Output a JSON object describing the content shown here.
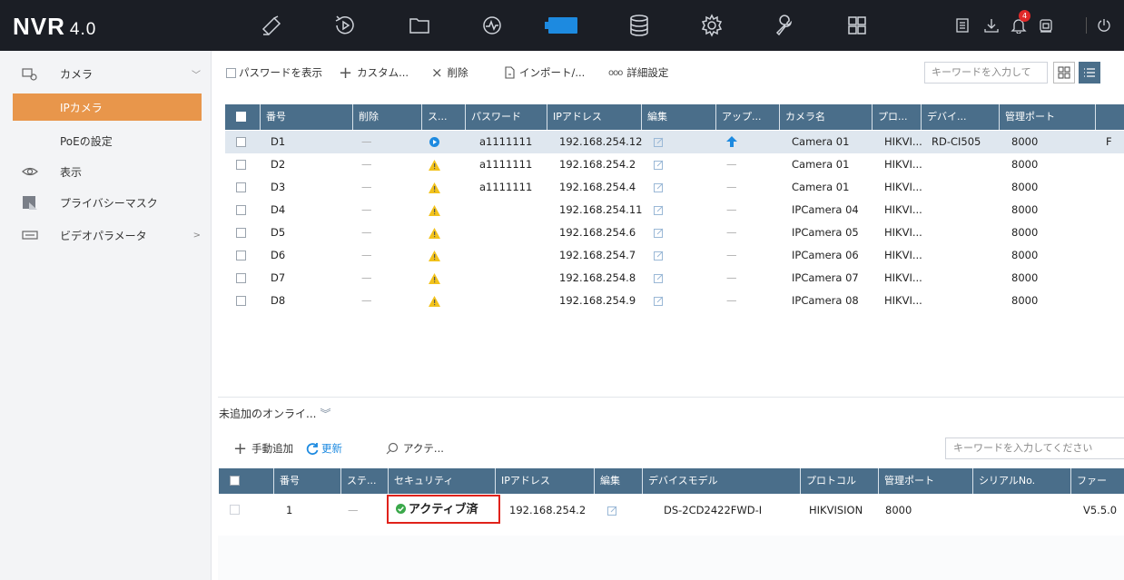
{
  "app": {
    "brand": "NVR",
    "version": "4.0"
  },
  "topnav": {
    "icons": [
      "live-view-icon",
      "playback-icon",
      "file-management-icon",
      "smart-analysis-icon",
      "camera-icon",
      "storage-icon",
      "system-icon",
      "maintenance-icon",
      "grid-icon"
    ],
    "right_icons": [
      "log-icon",
      "download-icon",
      "alarm-icon",
      "lock-icon",
      "power-icon"
    ],
    "alarm_count": "4",
    "active_index": 4
  },
  "sidebar": {
    "items": [
      {
        "label": "カメラ",
        "icon": "camera-icon",
        "chevron": "﹀"
      },
      {
        "label": "IPカメラ"
      },
      {
        "label": "PoEの設定"
      },
      {
        "label": "表示",
        "icon": "eye-icon"
      },
      {
        "label": "プライバシーマスク",
        "icon": "privacy-mask-icon"
      },
      {
        "label": "ビデオパラメータ",
        "icon": "video-param-icon",
        "chevron": ">"
      }
    ]
  },
  "toolbar": {
    "show_password": "パスワードを表示",
    "custom": "カスタム...",
    "delete": "削除",
    "import": "インポート/...",
    "advanced": "詳細設定",
    "search_placeholder": "キーワードを入力して"
  },
  "camera_table": {
    "headers": [
      "番号",
      "削除",
      "ス...",
      "パスワード",
      "IPアドレス",
      "編集",
      "アップ...",
      "カメラ名",
      "プロ...",
      "デバイ...",
      "管理ポート"
    ],
    "rows": [
      {
        "no": "D1",
        "delete": "—",
        "status": "ok",
        "password": "a1111111",
        "ip": "192.168.254.12",
        "upgrade": "up",
        "name": "Camera 01",
        "protocol": "HIKVI...",
        "device": "RD-CI505",
        "port": "8000",
        "extra": "F"
      },
      {
        "no": "D2",
        "delete": "—",
        "status": "warn",
        "password": "a1111111",
        "ip": "192.168.254.2",
        "upgrade": "—",
        "name": "Camera 01",
        "protocol": "HIKVI...",
        "device": "",
        "port": "8000",
        "extra": ""
      },
      {
        "no": "D3",
        "delete": "—",
        "status": "warn",
        "password": "a1111111",
        "ip": "192.168.254.4",
        "upgrade": "—",
        "name": "Camera 01",
        "protocol": "HIKVI...",
        "device": "",
        "port": "8000",
        "extra": ""
      },
      {
        "no": "D4",
        "delete": "—",
        "status": "warn",
        "password": "",
        "ip": "192.168.254.11",
        "upgrade": "—",
        "name": "IPCamera 04",
        "protocol": "HIKVI...",
        "device": "",
        "port": "8000",
        "extra": ""
      },
      {
        "no": "D5",
        "delete": "—",
        "status": "warn",
        "password": "",
        "ip": "192.168.254.6",
        "upgrade": "—",
        "name": "IPCamera 05",
        "protocol": "HIKVI...",
        "device": "",
        "port": "8000",
        "extra": ""
      },
      {
        "no": "D6",
        "delete": "—",
        "status": "warn",
        "password": "",
        "ip": "192.168.254.7",
        "upgrade": "—",
        "name": "IPCamera 06",
        "protocol": "HIKVI...",
        "device": "",
        "port": "8000",
        "extra": ""
      },
      {
        "no": "D7",
        "delete": "—",
        "status": "warn",
        "password": "",
        "ip": "192.168.254.8",
        "upgrade": "—",
        "name": "IPCamera 07",
        "protocol": "HIKVI...",
        "device": "",
        "port": "8000",
        "extra": ""
      },
      {
        "no": "D8",
        "delete": "—",
        "status": "warn",
        "password": "",
        "ip": "192.168.254.9",
        "upgrade": "—",
        "name": "IPCamera 08",
        "protocol": "HIKVI...",
        "device": "",
        "port": "8000",
        "extra": ""
      }
    ]
  },
  "online_panel": {
    "title": "未追加のオンライ...",
    "collapse": "≫",
    "manual_add": "手動追加",
    "refresh": "更新",
    "activate": "アクテ...",
    "search_placeholder": "キーワードを入力してください",
    "headers": [
      "番号",
      "ステ...",
      "セキュリティ",
      "IPアドレス",
      "編集",
      "デバイスモデル",
      "プロトコル",
      "管理ポート",
      "シリアルNo.",
      "ファー"
    ],
    "rows": [
      {
        "no": "1",
        "status": "—",
        "security": "アクティブ済",
        "ip": "192.168.254.2",
        "model": "DS-2CD2422FWD-I",
        "protocol": "HIKVISION",
        "port": "8000",
        "serial": "",
        "firmware": "V5.5.0"
      }
    ]
  },
  "colors": {
    "topbar": "#1b1e25",
    "accent": "#e8964b",
    "header": "#4a6e8a",
    "active_tab": "#1d8ae0",
    "highlight_box": "#e0221b"
  }
}
